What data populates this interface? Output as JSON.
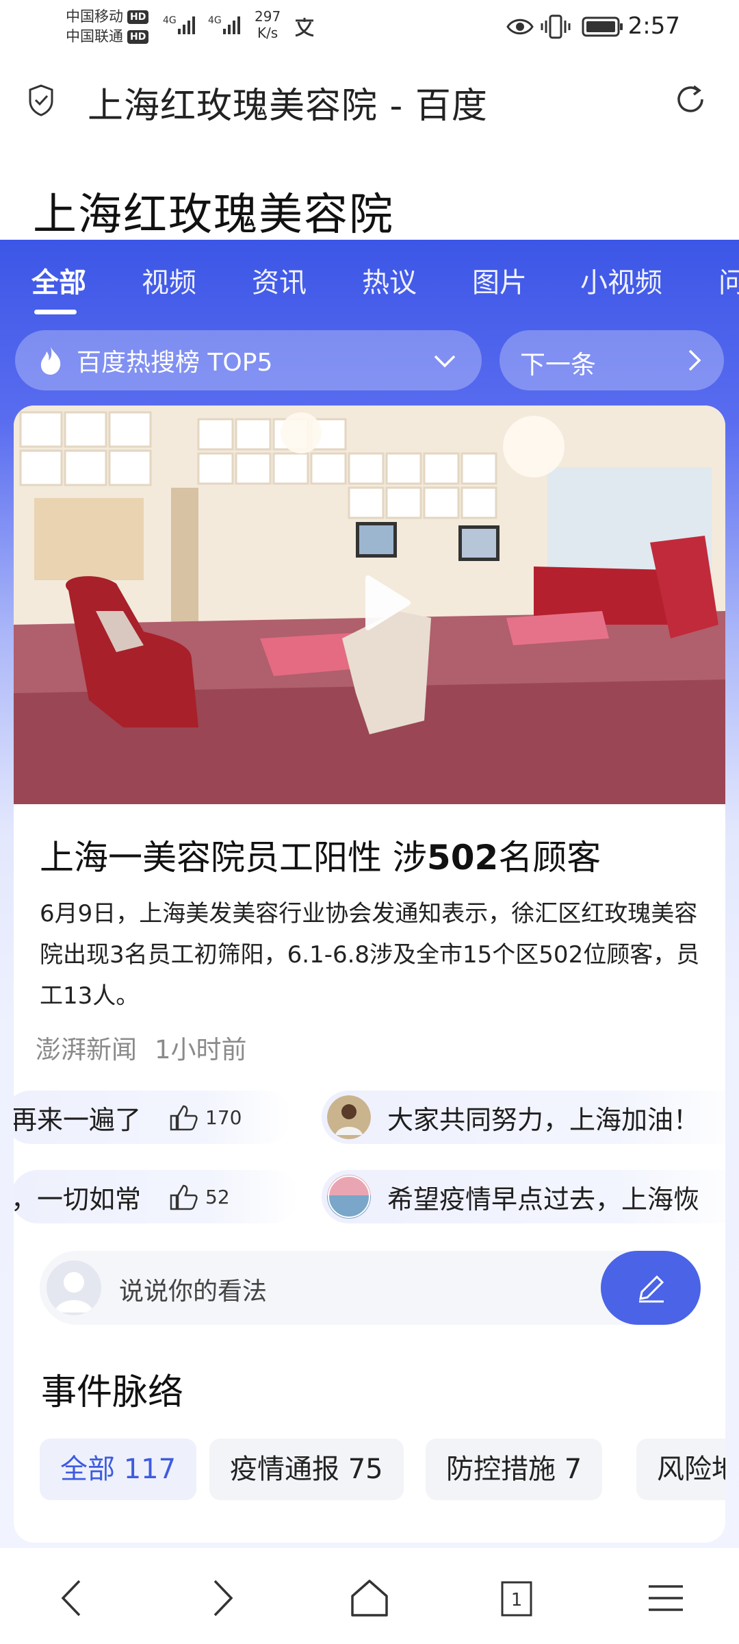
{
  "status_bar": {
    "carrier1": "中国移动",
    "carrier2": "中国联通",
    "hd": "HD",
    "signal1_label": "4G",
    "signal2_label": "4G",
    "net_speed_value": "297",
    "net_speed_unit": "K/s",
    "time": "2:57",
    "icons": [
      "translate-icon",
      "eye-icon",
      "vibrate-icon",
      "battery-icon"
    ]
  },
  "browser": {
    "title": "上海红玫瑰美容院 - 百度",
    "icons": [
      "shield-check-icon",
      "refresh-icon"
    ]
  },
  "search": {
    "query": "上海红玫瑰美容院"
  },
  "tabs": [
    "全部",
    "视频",
    "资讯",
    "热议",
    "图片",
    "小视频",
    "问"
  ],
  "hot_list": {
    "label": "百度热搜榜 TOP5",
    "next_label": "下一条"
  },
  "news_card": {
    "headline_prefix": "上海一美容院员工阳性 涉",
    "headline_number": "502",
    "headline_suffix": "名顾客",
    "summary": "6月9日，上海美发美容行业协会发通知表示，徐汇区红玫瑰美容院出现3名员工初筛阳，6.1-6.8涉及全市15个区502位顾客，员工13人。",
    "source": "澎湃新闻",
    "time": "1小时前"
  },
  "comments": {
    "row1_left_text": "再来一遍了",
    "row1_left_likes": "170",
    "row1_right_text": "大家共同努力，上海加油！",
    "row2_left_text": "，一切如常",
    "row2_left_likes": "52",
    "row2_right_text": "希望疫情早点过去，上海恢"
  },
  "comment_input": {
    "placeholder": "说说你的看法"
  },
  "timeline": {
    "title": "事件脉络",
    "chips": [
      "全部 117",
      "疫情通报 75",
      "防控措施 7",
      "风险地"
    ]
  },
  "colors": {
    "accent_blue": "#4a63e7",
    "header_blue": "#3c56e6",
    "chip_active_text": "#3e5be0"
  }
}
